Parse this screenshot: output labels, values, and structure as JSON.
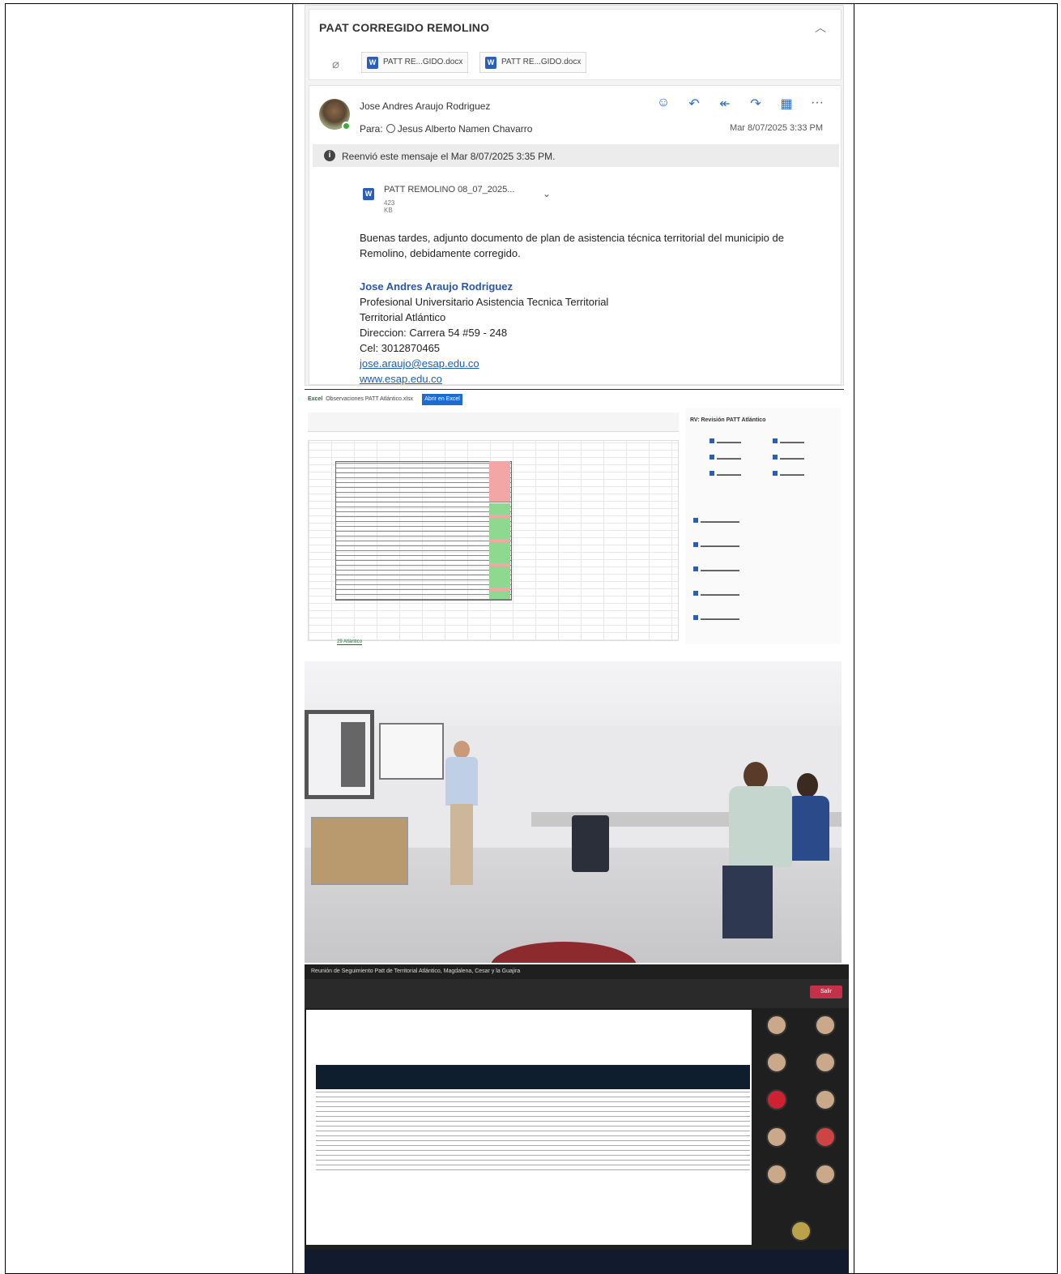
{
  "email": {
    "subject": "PAAT CORREGIDO REMOLINO",
    "attachments_top": [
      "PATT RE...GIDO.docx",
      "PATT RE...GIDO.docx"
    ],
    "sender": "Jose Andres Araujo Rodriguez",
    "to_label": "Para:",
    "to_name": "Jesus Alberto Namen Chavarro",
    "date": "Mar 8/07/2025 3:33 PM",
    "forward_note": "Reenvió este mensaje el Mar 8/07/2025 3:35 PM.",
    "file_name": "PATT REMOLINO 08_07_2025...",
    "file_size": "423 KB",
    "body": "Buenas tardes, adjunto documento de plan de asistencia técnica territorial del municipio de Remolino, debidamente corregido.",
    "signature": {
      "name": "Jose Andres Araujo Rodriguez",
      "title": "Profesional Universitario Asistencia Tecnica Territorial",
      "territory": "Territorial Atlántico",
      "address": "Direccion: Carrera 54 #59 - 248",
      "phone": "Cel: 3012870465",
      "email": "jose.araujo@esap.edu.co",
      "web": "www.esap.edu.co"
    }
  },
  "excel": {
    "app": "Excel",
    "title": "Observaciones PATT Atlántico.xlsx",
    "open_button": "Abrir en Excel",
    "side_title": "RV: Revisión PATT Atlántico",
    "sheet_tab": "29 Atlántico"
  },
  "teams": {
    "title": "Reunión de Seguimiento Patt de Territorial Atlántico, Magdalena, Cesar y la Guajira",
    "leave": "Salir"
  },
  "icons": [
    "paperclip-icon",
    "word-icon",
    "chevron-up-icon",
    "emoji-icon",
    "reply-icon",
    "reply-all-icon",
    "forward-icon",
    "calendar-icon",
    "more-icon",
    "info-icon",
    "chevron-down-icon"
  ]
}
